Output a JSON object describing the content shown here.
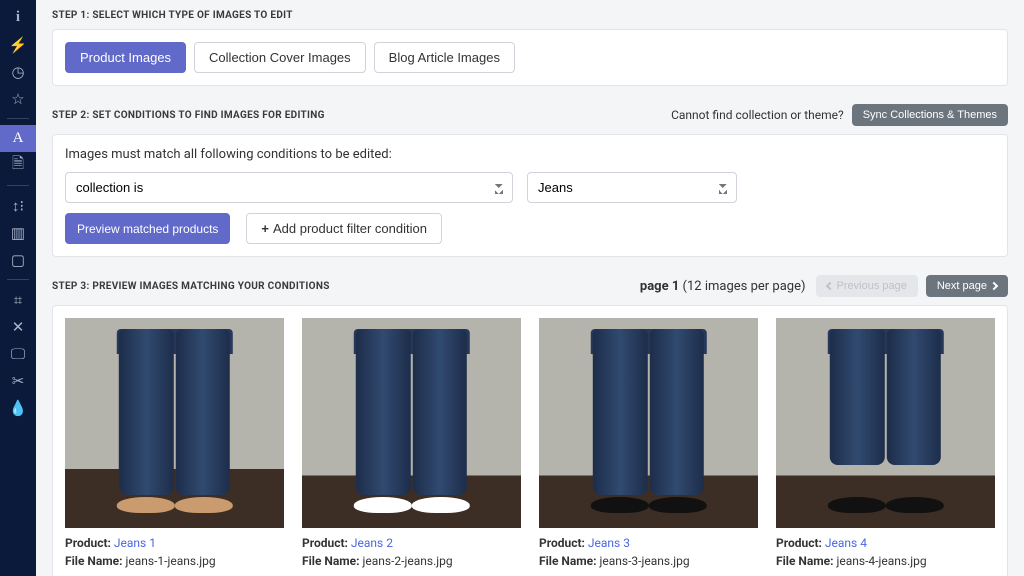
{
  "sidebar": {
    "icons": [
      {
        "name": "info-icon",
        "glyph": "i",
        "active": false,
        "style": "font-family:Georgia,serif;font-weight:bold;"
      },
      {
        "name": "bolt-icon",
        "glyph": "⚡",
        "active": false
      },
      {
        "name": "clock-icon",
        "glyph": "◷",
        "active": false
      },
      {
        "name": "star-icon",
        "glyph": "☆",
        "active": false
      },
      {
        "name": "divider"
      },
      {
        "name": "text-a-icon",
        "glyph": "A",
        "active": true,
        "style": "font-family:Georgia,serif;"
      },
      {
        "name": "document-icon",
        "glyph": "🗎",
        "active": false
      },
      {
        "name": "divider"
      },
      {
        "name": "sort-icon",
        "glyph": "↕⁝",
        "active": false
      },
      {
        "name": "chart-icon",
        "glyph": "▥",
        "active": false
      },
      {
        "name": "square-icon",
        "glyph": "▢",
        "active": false
      },
      {
        "name": "divider"
      },
      {
        "name": "crop-icon",
        "glyph": "⌗",
        "active": false
      },
      {
        "name": "expand-icon",
        "glyph": "✕",
        "active": false
      },
      {
        "name": "screen-icon",
        "glyph": "🖵",
        "active": false
      },
      {
        "name": "scissors-icon",
        "glyph": "✂",
        "active": false
      },
      {
        "name": "droplet-icon",
        "glyph": "💧",
        "active": false
      }
    ]
  },
  "step1": {
    "heading": "STEP 1: SELECT WHICH TYPE OF IMAGES TO EDIT",
    "tabs": [
      {
        "label": "Product Images",
        "active": true
      },
      {
        "label": "Collection Cover Images",
        "active": false
      },
      {
        "label": "Blog Article Images",
        "active": false
      }
    ]
  },
  "step2": {
    "heading": "STEP 2: SET CONDITIONS TO FIND IMAGES FOR EDITING",
    "notice_text": "Cannot find collection or theme?",
    "sync_button": "Sync Collections & Themes",
    "instruct": "Images must match all following conditions to be edited:",
    "condition_field": "collection is",
    "condition_value": "Jeans",
    "preview_button": "Preview matched products",
    "add_filter_button": "Add product filter condition"
  },
  "step3": {
    "heading": "STEP 3: PREVIEW IMAGES MATCHING YOUR CONDITIONS",
    "page_label": "page 1",
    "per_page_label": "(12 images per page)",
    "prev_page": "Previous page",
    "next_page": "Next page",
    "items": [
      {
        "product_label": "Product:",
        "product_link": "Jeans 1",
        "file_label": "File Name:",
        "file_name": "jeans-1-jeans.jpg",
        "thumb_variant": "v1"
      },
      {
        "product_label": "Product:",
        "product_link": "Jeans 2",
        "file_label": "File Name:",
        "file_name": "jeans-2-jeans.jpg",
        "thumb_variant": "v2"
      },
      {
        "product_label": "Product:",
        "product_link": "Jeans 3",
        "file_label": "File Name:",
        "file_name": "jeans-3-jeans.jpg",
        "thumb_variant": "v3"
      },
      {
        "product_label": "Product:",
        "product_link": "Jeans 4",
        "file_label": "File Name:",
        "file_name": "jeans-4-jeans.jpg",
        "thumb_variant": "v4"
      }
    ]
  }
}
